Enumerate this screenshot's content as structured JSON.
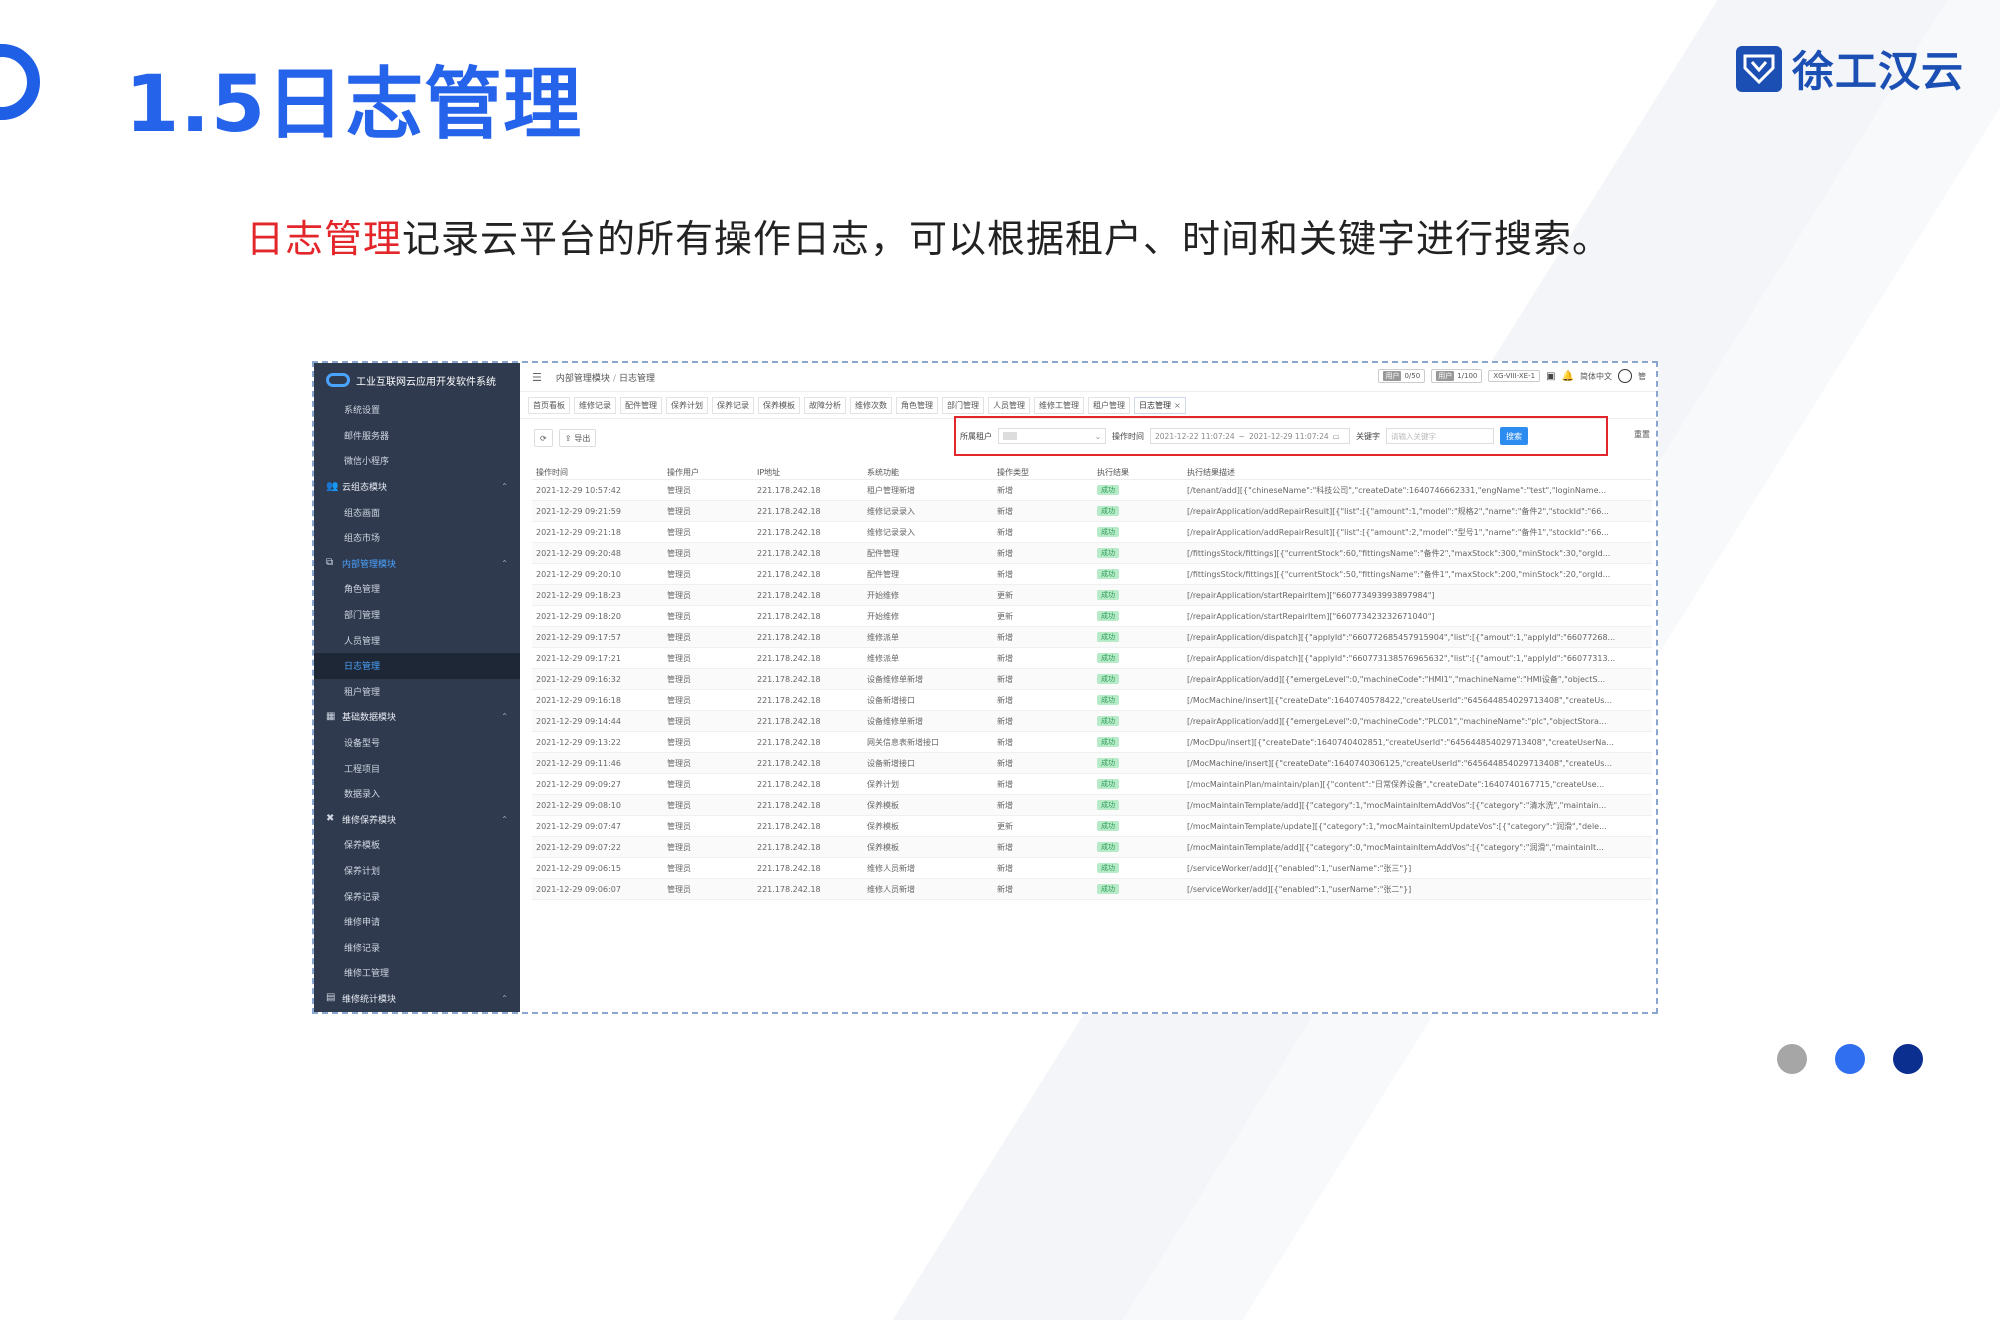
{
  "slide": {
    "title": "1.5日志管理",
    "brand": "徐工汉云",
    "subtitle_highlight": "日志管理",
    "subtitle_rest": "记录云平台的所有操作日志，可以根据租户、时间和关键字进行搜索。",
    "dot_colors": [
      "#a6a6a6",
      "#2f6ff0",
      "#0b2f8f"
    ]
  },
  "app": {
    "system_name": "工业互联网云应用开发软件系统",
    "sidebar": [
      {
        "type": "sub",
        "label": "系统设置"
      },
      {
        "type": "sub",
        "label": "邮件服务器"
      },
      {
        "type": "sub",
        "label": "微信小程序"
      },
      {
        "type": "group",
        "label": "云组态模块",
        "icon": "users-icon"
      },
      {
        "type": "sub",
        "label": "组态画面"
      },
      {
        "type": "sub",
        "label": "组态市场"
      },
      {
        "type": "group",
        "label": "内部管理模块",
        "icon": "org-icon",
        "active": true
      },
      {
        "type": "sub",
        "label": "角色管理"
      },
      {
        "type": "sub",
        "label": "部门管理"
      },
      {
        "type": "sub",
        "label": "人员管理"
      },
      {
        "type": "sub",
        "label": "日志管理",
        "selected": true
      },
      {
        "type": "sub",
        "label": "租户管理"
      },
      {
        "type": "group",
        "label": "基础数据模块",
        "icon": "grid-icon"
      },
      {
        "type": "sub",
        "label": "设备型号"
      },
      {
        "type": "sub",
        "label": "工程项目"
      },
      {
        "type": "sub",
        "label": "数据录入"
      },
      {
        "type": "group",
        "label": "维修保养模块",
        "icon": "wrench-icon"
      },
      {
        "type": "sub",
        "label": "保养模板"
      },
      {
        "type": "sub",
        "label": "保养计划"
      },
      {
        "type": "sub",
        "label": "保养记录"
      },
      {
        "type": "sub",
        "label": "维修申请"
      },
      {
        "type": "sub",
        "label": "维修记录"
      },
      {
        "type": "sub",
        "label": "维修工管理"
      },
      {
        "type": "group",
        "label": "维修统计模块",
        "icon": "chart-icon"
      }
    ],
    "breadcrumb": [
      "内部管理模块",
      "日志管理"
    ],
    "topbar": {
      "chip1_tag": "用户",
      "chip1_value": "0/50",
      "chip2_tag": "用户",
      "chip2_value": "1/100",
      "device": "XG-VIII-XE-1",
      "language": "简体中文",
      "user": "管"
    },
    "tabs": [
      "首页看板",
      "维修记录",
      "配件管理",
      "保养计划",
      "保养记录",
      "保养模板",
      "故障分析",
      "维修次数",
      "角色管理",
      "部门管理",
      "人员管理",
      "维修工管理",
      "租户管理",
      "日志管理"
    ],
    "toolbar": {
      "refresh": "",
      "export": "导出"
    },
    "search": {
      "tenant_label": "所属租户",
      "time_label": "操作时间",
      "start": "2021-12-22 11:07:24",
      "end": "2021-12-29 11:07:24",
      "keyword_label": "关键字",
      "keyword_placeholder": "请输入关键字",
      "search_btn": "搜索",
      "reset_btn": "重置"
    },
    "columns": [
      "操作时间",
      "操作用户",
      "IP地址",
      "系统功能",
      "操作类型",
      "执行结果",
      "执行结果描述"
    ],
    "rows": [
      [
        "2021-12-29 10:57:42",
        "管理员",
        "221.178.242.18",
        "租户管理新增",
        "新增",
        "成功",
        "[/tenant/add][{\"chineseName\":\"科技公司\",\"createDate\":1640746662331,\"engName\":\"test\",\"loginName..."
      ],
      [
        "2021-12-29 09:21:59",
        "管理员",
        "221.178.242.18",
        "维修记录录入",
        "新增",
        "成功",
        "[/repairApplication/addRepairResult][{\"list\":[{\"amount\":1,\"model\":\"规格2\",\"name\":\"备件2\",\"stockId\":\"66..."
      ],
      [
        "2021-12-29 09:21:18",
        "管理员",
        "221.178.242.18",
        "维修记录录入",
        "新增",
        "成功",
        "[/repairApplication/addRepairResult][{\"list\":[{\"amount\":2,\"model\":\"型号1\",\"name\":\"备件1\",\"stockId\":\"66..."
      ],
      [
        "2021-12-29 09:20:48",
        "管理员",
        "221.178.242.18",
        "配件管理",
        "新增",
        "成功",
        "[/fittingsStock/fittings][{\"currentStock\":60,\"fittingsName\":\"备件2\",\"maxStock\":300,\"minStock\":30,\"orgId..."
      ],
      [
        "2021-12-29 09:20:10",
        "管理员",
        "221.178.242.18",
        "配件管理",
        "新增",
        "成功",
        "[/fittingsStock/fittings][{\"currentStock\":50,\"fittingsName\":\"备件1\",\"maxStock\":200,\"minStock\":20,\"orgId..."
      ],
      [
        "2021-12-29 09:18:23",
        "管理员",
        "221.178.242.18",
        "开始维修",
        "更新",
        "成功",
        "[/repairApplication/startRepairItem][\"660773493993897984\"]"
      ],
      [
        "2021-12-29 09:18:20",
        "管理员",
        "221.178.242.18",
        "开始维修",
        "更新",
        "成功",
        "[/repairApplication/startRepairItem][\"660773423232671040\"]"
      ],
      [
        "2021-12-29 09:17:57",
        "管理员",
        "221.178.242.18",
        "维修派单",
        "新增",
        "成功",
        "[/repairApplication/dispatch][{\"applyId\":\"660772685457915904\",\"list\":[{\"amout\":1,\"applyId\":\"66077268..."
      ],
      [
        "2021-12-29 09:17:21",
        "管理员",
        "221.178.242.18",
        "维修派单",
        "新增",
        "成功",
        "[/repairApplication/dispatch][{\"applyId\":\"660773138576965632\",\"list\":[{\"amout\":1,\"applyId\":\"66077313..."
      ],
      [
        "2021-12-29 09:16:32",
        "管理员",
        "221.178.242.18",
        "设备维修单新增",
        "新增",
        "成功",
        "[/repairApplication/add][{\"emergeLevel\":0,\"machineCode\":\"HMI1\",\"machineName\":\"HMI设备\",\"objectS..."
      ],
      [
        "2021-12-29 09:16:18",
        "管理员",
        "221.178.242.18",
        "设备新增接口",
        "新增",
        "成功",
        "[/MocMachine/insert][{\"createDate\":1640740578422,\"createUserId\":\"645644854029713408\",\"createUs..."
      ],
      [
        "2021-12-29 09:14:44",
        "管理员",
        "221.178.242.18",
        "设备维修单新增",
        "新增",
        "成功",
        "[/repairApplication/add][{\"emergeLevel\":0,\"machineCode\":\"PLC01\",\"machineName\":\"plc\",\"objectStora..."
      ],
      [
        "2021-12-29 09:13:22",
        "管理员",
        "221.178.242.18",
        "网关信息表新增接口",
        "新增",
        "成功",
        "[/MocDpu/insert][{\"createDate\":1640740402851,\"createUserId\":\"645644854029713408\",\"createUserNa..."
      ],
      [
        "2021-12-29 09:11:46",
        "管理员",
        "221.178.242.18",
        "设备新增接口",
        "新增",
        "成功",
        "[/MocMachine/insert][{\"createDate\":1640740306125,\"createUserId\":\"645644854029713408\",\"createUs..."
      ],
      [
        "2021-12-29 09:09:27",
        "管理员",
        "221.178.242.18",
        "保养计划",
        "新增",
        "成功",
        "[/mocMaintainPlan/maintain/plan][{\"content\":\"日常保养设备\",\"createDate\":1640740167715,\"createUse..."
      ],
      [
        "2021-12-29 09:08:10",
        "管理员",
        "221.178.242.18",
        "保养模板",
        "新增",
        "成功",
        "[/mocMaintainTemplate/add][{\"category\":1,\"mocMaintainItemAddVos\":[{\"category\":\"清水洗\",\"maintain..."
      ],
      [
        "2021-12-29 09:07:47",
        "管理员",
        "221.178.242.18",
        "保养模板",
        "更新",
        "成功",
        "[/mocMaintainTemplate/update][{\"category\":1,\"mocMaintainItemUpdateVos\":[{\"category\":\"润滑\",\"dele..."
      ],
      [
        "2021-12-29 09:07:22",
        "管理员",
        "221.178.242.18",
        "保养模板",
        "新增",
        "成功",
        "[/mocMaintainTemplate/add][{\"category\":0,\"mocMaintainItemAddVos\":[{\"category\":\"润滑\",\"maintainIt..."
      ],
      [
        "2021-12-29 09:06:15",
        "管理员",
        "221.178.242.18",
        "维修人员新增",
        "新增",
        "成功",
        "[/serviceWorker/add][{\"enabled\":1,\"userName\":\"张三\"}]"
      ],
      [
        "2021-12-29 09:06:07",
        "管理员",
        "221.178.242.18",
        "维修人员新增",
        "新增",
        "成功",
        "[/serviceWorker/add][{\"enabled\":1,\"userName\":\"张二\"}]"
      ]
    ]
  }
}
